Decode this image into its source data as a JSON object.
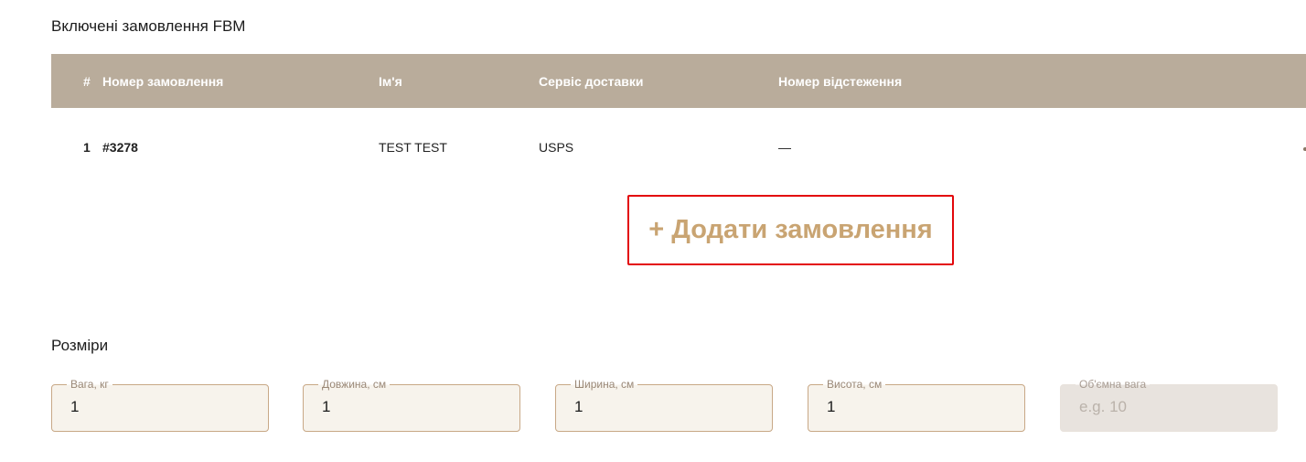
{
  "orders_section": {
    "title": "Включені замовлення FBM",
    "columns": {
      "index": "#",
      "order_number": "Номер замовлення",
      "name": "Ім'я",
      "delivery_service": "Сервіс доставки",
      "tracking_number": "Номер відстеження"
    },
    "rows": [
      {
        "index": "1",
        "order_number": "#3278",
        "name": "TEST TEST",
        "delivery_service": "USPS",
        "tracking_number": "—"
      }
    ],
    "add_order_label": "+ Додати замовлення"
  },
  "dimensions_section": {
    "title": "Розміри",
    "fields": [
      {
        "label": "Вага, кг",
        "value": "1",
        "placeholder": ""
      },
      {
        "label": "Довжина, см",
        "value": "1",
        "placeholder": ""
      },
      {
        "label": "Ширина, см",
        "value": "1",
        "placeholder": ""
      },
      {
        "label": "Висота, см",
        "value": "1",
        "placeholder": ""
      },
      {
        "label": "Об'ємна вага",
        "value": "",
        "placeholder": "e.g. 10",
        "disabled": true
      }
    ]
  },
  "colors": {
    "table_header_bg": "#b9ac9b",
    "accent": "#c9a472",
    "highlight_border": "#e3070b",
    "field_border": "#c8a886",
    "field_bg": "#f7f3ec"
  }
}
